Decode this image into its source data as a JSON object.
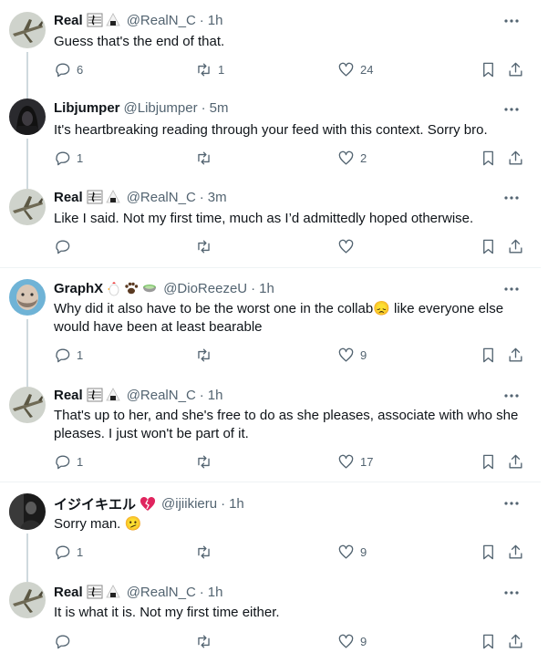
{
  "tweets": [
    {
      "name": "Real",
      "handle": "@RealN_C",
      "time": "1h",
      "text": "Guess that's the end of that.",
      "replies": "6",
      "retweets": "1",
      "likes": "24",
      "avatar": "plane-avatar",
      "badges": [
        "music-note-icon",
        "onigiri-icon"
      ]
    },
    {
      "name": "Libjumper",
      "handle": "@Libjumper",
      "time": "5m",
      "text": "It's heartbreaking reading through your feed with this context. Sorry bro.",
      "replies": "1",
      "retweets": "",
      "likes": "2",
      "avatar": "hooded-figure-avatar",
      "badges": []
    },
    {
      "name": "Real",
      "handle": "@RealN_C",
      "time": "3m",
      "text": "Like I said. Not my first time, much as I’d admittedly hoped otherwise.",
      "replies": "",
      "retweets": "",
      "likes": "",
      "avatar": "plane-avatar",
      "badges": [
        "music-note-icon",
        "onigiri-icon"
      ]
    },
    {
      "name": "GraphX",
      "handle": "@DioReezeU",
      "time": "1h",
      "text": "Why did it also have to be the worst one in the collab😞 like everyone else would have been at least bearable",
      "replies": "1",
      "retweets": "",
      "likes": "9",
      "avatar": "bearded-face-avatar",
      "badges": [
        "chicken-icon",
        "paw-icon",
        "bowl-icon"
      ]
    },
    {
      "name": "Real",
      "handle": "@RealN_C",
      "time": "1h",
      "text": "That's up to her, and she's free to do as she pleases, associate with who she pleases. I just won't be part of it.",
      "replies": "1",
      "retweets": "",
      "likes": "17",
      "avatar": "plane-avatar",
      "badges": [
        "music-note-icon",
        "onigiri-icon"
      ]
    },
    {
      "name": "イジイキエル",
      "handle": "@ijiikieru",
      "time": "1h",
      "text": "Sorry man. 🫤",
      "replies": "1",
      "retweets": "",
      "likes": "9",
      "avatar": "dark-figure-avatar",
      "badges": [
        "broken-heart-icon"
      ]
    },
    {
      "name": "Real",
      "handle": "@RealN_C",
      "time": "1h",
      "text": "It is what it is. Not my first time either.",
      "replies": "",
      "retweets": "",
      "likes": "9",
      "avatar": "plane-avatar",
      "badges": [
        "music-note-icon",
        "onigiri-icon"
      ]
    }
  ],
  "colors": {
    "text": "#0f1419",
    "secondary": "#536471",
    "thread_line": "#cfd9de",
    "separator": "#eff3f4"
  },
  "separator": "·"
}
